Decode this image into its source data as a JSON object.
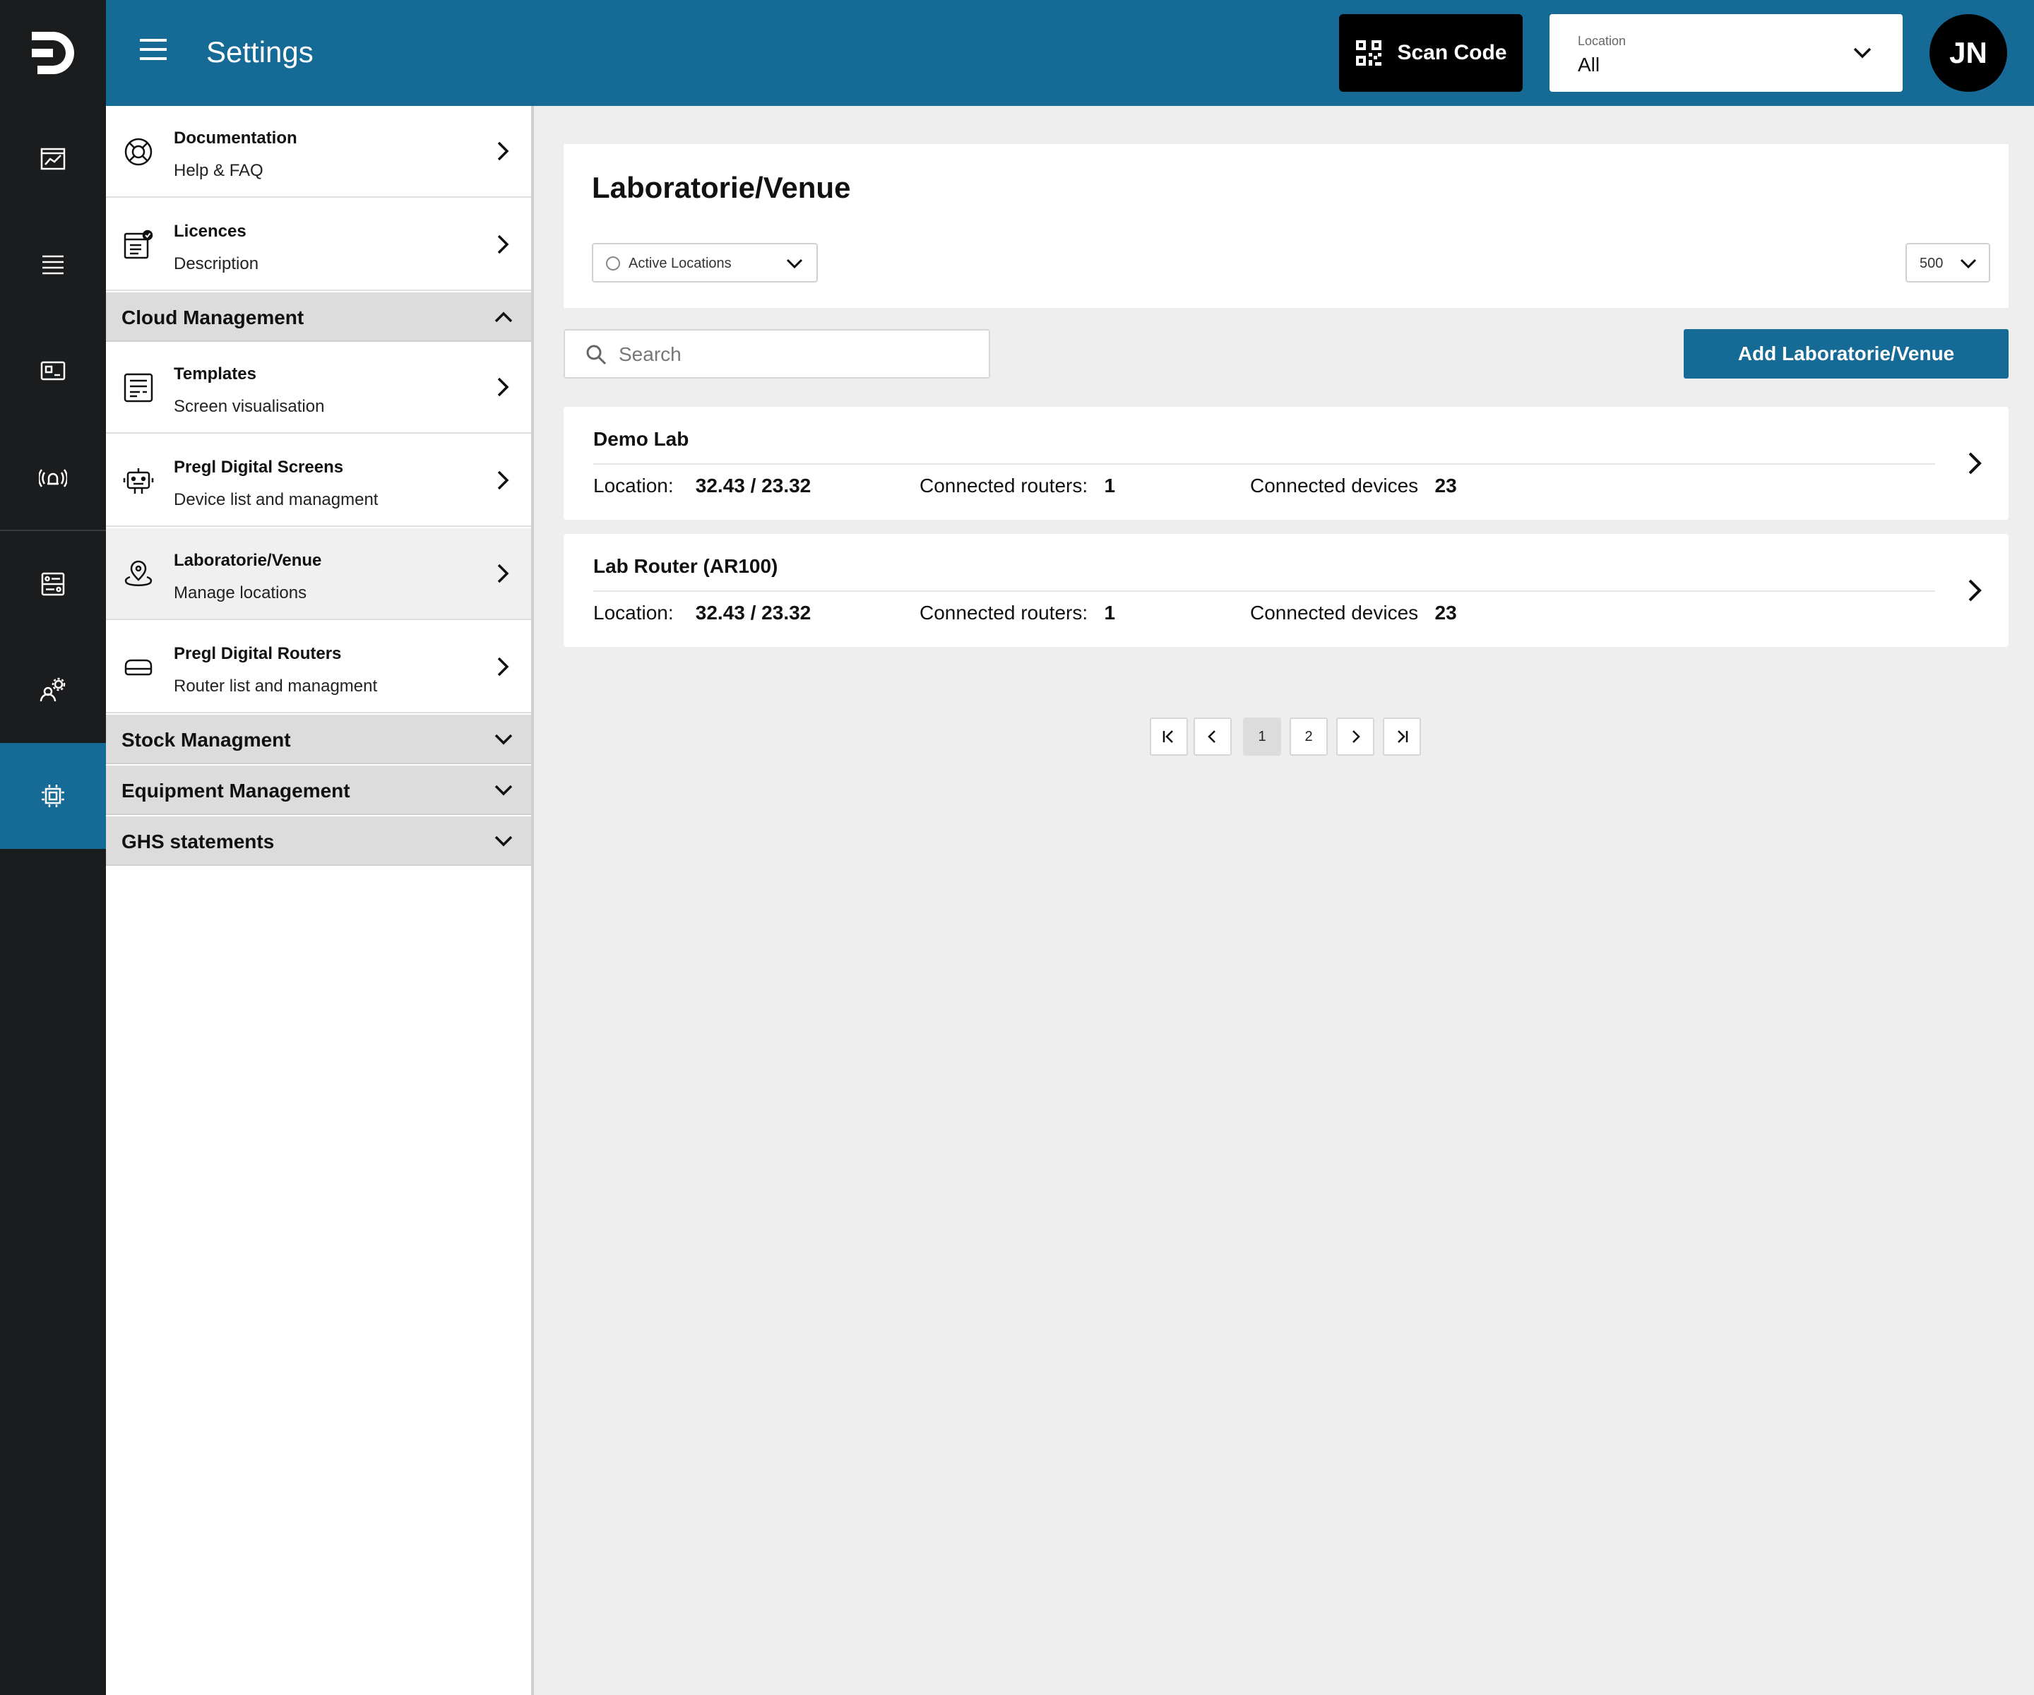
{
  "header": {
    "title": "Settings",
    "scan_label": "Scan Code",
    "location_label": "Location",
    "location_value": "All",
    "avatar_initials": "JN"
  },
  "menu": {
    "items": [
      {
        "title": "Documentation",
        "subtitle": "Help & FAQ",
        "icon": "lifebuoy-icon"
      },
      {
        "title": "Licences",
        "subtitle": "Description",
        "icon": "licence-icon"
      },
      {
        "title": "Templates",
        "subtitle": "Screen visualisation",
        "icon": "template-icon"
      },
      {
        "title": "Pregl Digital Screens",
        "subtitle": "Device list and managment",
        "icon": "robot-icon"
      },
      {
        "title": "Laboratorie/Venue",
        "subtitle": "Manage locations",
        "icon": "location-pin-icon"
      },
      {
        "title": "Pregl Digital Routers",
        "subtitle": "Router list and managment",
        "icon": "router-icon"
      }
    ],
    "sections": [
      {
        "title": "Cloud Management",
        "expanded": true
      },
      {
        "title": "Stock Managment",
        "expanded": false
      },
      {
        "title": "Equipment Management",
        "expanded": false
      },
      {
        "title": "GHS statements",
        "expanded": false
      }
    ]
  },
  "content": {
    "title": "Laboratorie/Venue",
    "filter": "Active Locations",
    "page_size": "500",
    "search_placeholder": "Search",
    "add_label": "Add Laboratorie/Venue",
    "rows": [
      {
        "name": "Demo Lab",
        "location_label": "Location:",
        "location": "32.43 / 23.32",
        "routers_label": "Connected routers:",
        "routers": "1",
        "devices_label": "Connected devices",
        "devices": "23"
      },
      {
        "name": "Lab Router (AR100)",
        "location_label": "Location:",
        "location": "32.43 / 23.32",
        "routers_label": "Connected routers:",
        "routers": "1",
        "devices_label": "Connected devices",
        "devices": "23"
      }
    ],
    "pagination": {
      "pages": [
        "1",
        "2"
      ],
      "current": "1"
    }
  },
  "colors": {
    "brand": "#166a96",
    "rail": "#1b1c1e"
  }
}
